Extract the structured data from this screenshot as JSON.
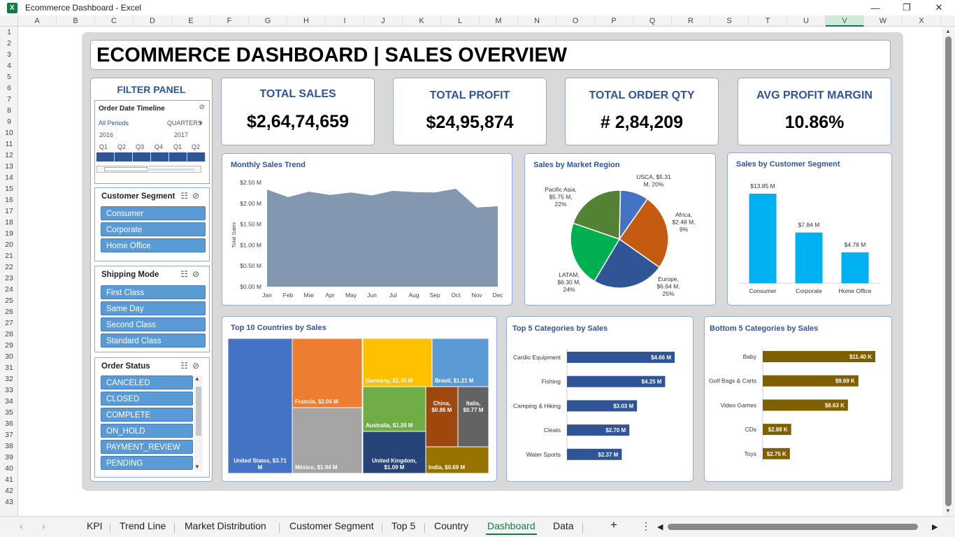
{
  "window": {
    "title": "Ecommerce Dashboard - Excel",
    "min": "—",
    "max": "❐",
    "close": "✕"
  },
  "columns": [
    "A",
    "B",
    "C",
    "D",
    "E",
    "F",
    "G",
    "H",
    "I",
    "J",
    "K",
    "L",
    "M",
    "N",
    "O",
    "P",
    "Q",
    "R",
    "S",
    "T",
    "U",
    "V",
    "W",
    "X"
  ],
  "selected_column": "V",
  "rows": [
    "1",
    "2",
    "3",
    "4",
    "5",
    "6",
    "7",
    "8",
    "9",
    "10",
    "11",
    "12",
    "13",
    "14",
    "15",
    "16",
    "17",
    "18",
    "19",
    "20",
    "21",
    "22",
    "23",
    "24",
    "25",
    "26",
    "27",
    "28",
    "29",
    "30",
    "31",
    "32",
    "33",
    "34",
    "35",
    "36",
    "37",
    "38",
    "39",
    "40",
    "41",
    "42",
    "43"
  ],
  "dashboard": {
    "title": "ECOMMERCE DASHBOARD | SALES OVERVIEW",
    "kpis": [
      {
        "label": "TOTAL SALES",
        "value": "$2,64,74,659"
      },
      {
        "label": "TOTAL PROFIT",
        "value": "$24,95,874"
      },
      {
        "label": "TOTAL ORDER QTY",
        "value": "# 2,84,209"
      },
      {
        "label": "AVG PROFIT MARGIN",
        "value": "10.86%"
      }
    ]
  },
  "filter_panel": {
    "title": "FILTER PANEL",
    "timeline": {
      "title": "Order Date Timeline",
      "all_periods": "All Periods",
      "granularity": "QUARTERS",
      "years": [
        "2016",
        "2017"
      ],
      "quarters": [
        "Q1",
        "Q2",
        "Q3",
        "Q4",
        "Q1",
        "Q2"
      ]
    },
    "customer_segment": {
      "title": "Customer Segment",
      "items": [
        "Consumer",
        "Corporate",
        "Home Office"
      ]
    },
    "shipping_mode": {
      "title": "Shipping Mode",
      "items": [
        "First Class",
        "Same Day",
        "Second Class",
        "Standard Class"
      ]
    },
    "order_status": {
      "title": "Order Status",
      "items": [
        "CANCELED",
        "CLOSED",
        "COMPLETE",
        "ON_HOLD",
        "PAYMENT_REVIEW",
        "PENDING"
      ]
    }
  },
  "chart_data": [
    {
      "type": "area",
      "title": "Monthly Sales Trend",
      "ylabel": "Total Sales",
      "categories": [
        "Jan",
        "Feb",
        "Mar",
        "Apr",
        "May",
        "Jun",
        "Jul",
        "Aug",
        "Sep",
        "Oct",
        "Nov",
        "Dec"
      ],
      "values": [
        2.33,
        2.15,
        2.28,
        2.2,
        2.26,
        2.19,
        2.3,
        2.27,
        2.26,
        2.35,
        1.9,
        1.93
      ],
      "yticks": [
        "$0.00 M",
        "$0.50 M",
        "$1.00 M",
        "$1.50 M",
        "$2.00 M",
        "$2.50 M"
      ],
      "ylim": [
        0,
        2.5
      ],
      "color": "#8497b0"
    },
    {
      "type": "pie",
      "title": "Sales by Market Region",
      "slices": [
        {
          "name": "USCA",
          "value": 5.31,
          "pct": 20,
          "label": [
            "USCA, $5.31",
            "M, 20%"
          ],
          "color": "#548235"
        },
        {
          "name": "Africa",
          "value": 2.48,
          "pct": 9,
          "label": [
            "Africa,",
            "$2.48 M,",
            "9%"
          ],
          "color": "#4472c4"
        },
        {
          "name": "Europe",
          "value": 6.64,
          "pct": 25,
          "label": [
            "Europe,",
            "$6.64 M,",
            "25%"
          ],
          "color": "#c55a11"
        },
        {
          "name": "LATAM",
          "value": 6.3,
          "pct": 24,
          "label": [
            "LATAM,",
            "$6.30 M,",
            "24%"
          ],
          "color": "#2f5597"
        },
        {
          "name": "Pacific Asia",
          "value": 5.75,
          "pct": 22,
          "label": [
            "Pacific Asia,",
            "$5.75 M,",
            "22%"
          ],
          "color": "#00b050"
        }
      ]
    },
    {
      "type": "bar",
      "title": "Sales by Customer Segment",
      "categories": [
        "Consumer",
        "Corporate",
        "Home Office"
      ],
      "values": [
        13.85,
        7.84,
        4.78
      ],
      "labels": [
        "$13.85 M",
        "$7.84 M",
        "$4.78 M"
      ],
      "color": "#00b0f0"
    },
    {
      "type": "treemap",
      "title": "Top 10 Countries by Sales",
      "items": [
        {
          "name": "United States",
          "value": 3.71,
          "label": "United States, $3.71 M",
          "color": "#4472c4"
        },
        {
          "name": "Francia",
          "value": 2.06,
          "label": "Francia, $2.06 M",
          "color": "#ed7d31"
        },
        {
          "name": "México",
          "value": 1.94,
          "label": "México, $1.94 M",
          "color": "#a5a5a5"
        },
        {
          "name": "Germany",
          "value": 1.45,
          "label": "Germany, $1.45 M",
          "color": "#ffc000"
        },
        {
          "name": "Brasil",
          "value": 1.21,
          "label": "Brasil, $1.21 M",
          "color": "#5b9bd5"
        },
        {
          "name": "Australia",
          "value": 1.2,
          "label": "Australia, $1.20 M",
          "color": "#70ad47"
        },
        {
          "name": "United Kingdom",
          "value": 1.09,
          "label": "United Kingdom, $1.09 M",
          "color": "#264478"
        },
        {
          "name": "China",
          "value": 0.86,
          "label": "China, $0.86 M",
          "color": "#9e480e"
        },
        {
          "name": "Italia",
          "value": 0.77,
          "label": "Italia, $0.77 M",
          "color": "#636363"
        },
        {
          "name": "India",
          "value": 0.69,
          "label": "India, $0.69 M",
          "color": "#997300"
        }
      ]
    },
    {
      "type": "bar",
      "orientation": "horizontal",
      "title": "Top 5 Categories by Sales",
      "categories": [
        "Cardio Equipment",
        "Fishing",
        "Camping & Hiking",
        "Cleats",
        "Water Sports"
      ],
      "values": [
        4.66,
        4.25,
        3.03,
        2.7,
        2.37
      ],
      "labels": [
        "$4.66 M",
        "$4.25 M",
        "$3.03 M",
        "$2.70 M",
        "$2.37 M"
      ],
      "color": "#2f5597"
    },
    {
      "type": "bar",
      "orientation": "horizontal",
      "title": "Bottom 5 Categories by Sales",
      "categories": [
        "Baby",
        "Golf Bags & Carts",
        "Video Games",
        "CDs",
        "Toys"
      ],
      "values": [
        11.4,
        9.69,
        8.63,
        2.88,
        2.75
      ],
      "labels": [
        "$11.40 K",
        "$9.69 K",
        "$8.63 K",
        "$2.88 K",
        "$2.75 K"
      ],
      "color": "#7f6000"
    }
  ],
  "sheet_tabs": [
    "KPI",
    "Trend Line",
    "Market Distribution",
    "Customer Segment",
    "Top 5",
    "Country",
    "Dashboard",
    "Data"
  ],
  "active_tab": "Dashboard",
  "tab_controls": {
    "prev": "‹",
    "next": "›",
    "add": "+",
    "more": "⋮"
  }
}
